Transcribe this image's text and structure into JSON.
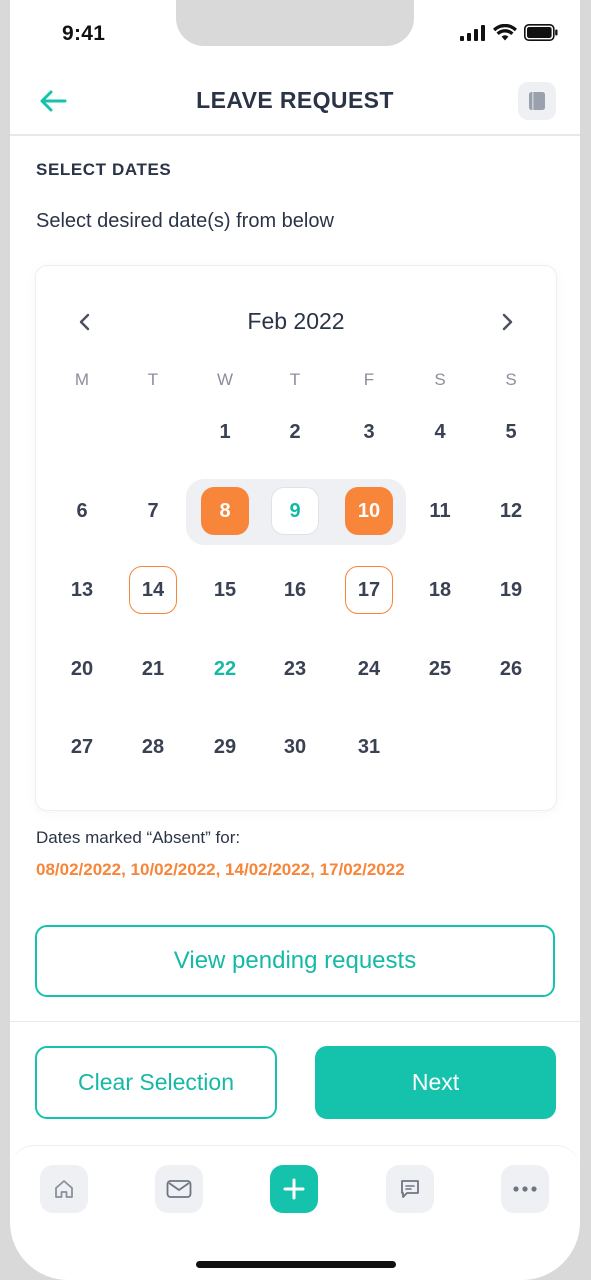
{
  "status_bar": {
    "time": "9:41"
  },
  "header": {
    "title": "LEAVE REQUEST"
  },
  "section_label": "SELECT DATES",
  "instruction": "Select desired date(s) from below",
  "calendar": {
    "month": "Feb 2022",
    "weekdays": [
      "M",
      "T",
      "W",
      "T",
      "F",
      "S",
      "S"
    ],
    "days": {
      "1": "1",
      "2": "2",
      "3": "3",
      "4": "4",
      "5": "5",
      "6": "6",
      "7": "7",
      "8": "8",
      "9": "9",
      "10": "10",
      "11": "11",
      "12": "12",
      "13": "13",
      "14": "14",
      "15": "15",
      "16": "16",
      "17": "17",
      "18": "18",
      "19": "19",
      "20": "20",
      "21": "21",
      "22": "22",
      "23": "23",
      "24": "24",
      "25": "25",
      "26": "26",
      "27": "27",
      "28": "28",
      "29": "29",
      "30": "30",
      "31": "31"
    }
  },
  "absent_info": {
    "label": "Dates marked “Absent” for:",
    "dates": "08/02/2022, 10/02/2022, 14/02/2022, 17/02/2022"
  },
  "buttons": {
    "view_pending": "View pending requests",
    "clear": "Clear Selection",
    "next": "Next"
  },
  "tab_bar": {
    "items": [
      "home-icon",
      "mail-icon",
      "plus-icon",
      "chat-icon",
      "more-icon"
    ]
  },
  "colors": {
    "accent": "#15c3ad",
    "absent": "#f7853a",
    "text": "#2b3447"
  }
}
